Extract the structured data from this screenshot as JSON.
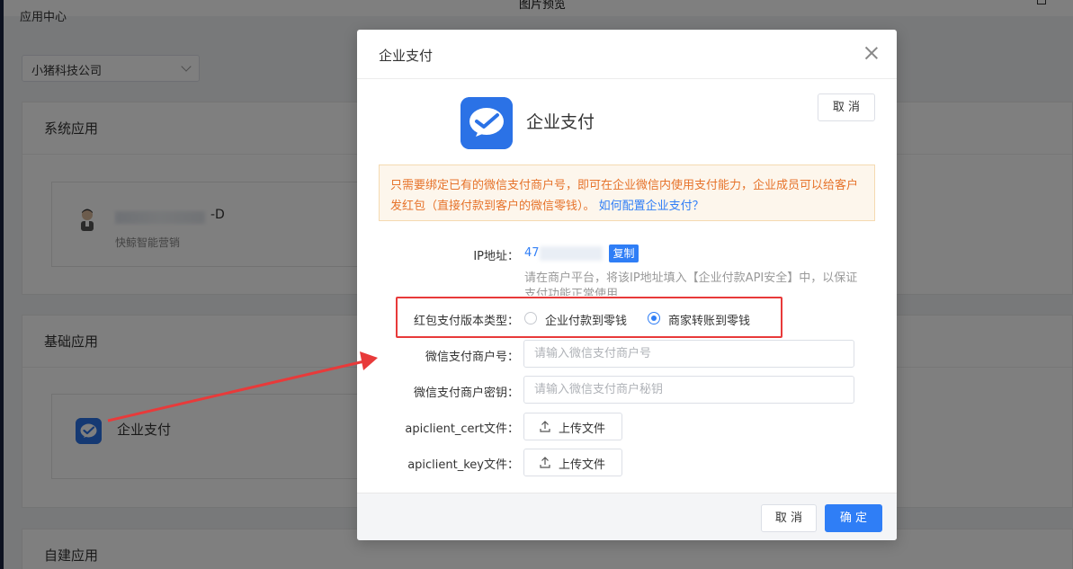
{
  "window": {
    "title": "图片预览"
  },
  "page": {
    "title": "应用中心",
    "company_select": {
      "value": "小猪科技公司"
    },
    "sections": {
      "system": {
        "heading": "系统应用",
        "app": {
          "name_suffix": "-D",
          "subtitle": "快鲸智能营销"
        }
      },
      "basic": {
        "heading": "基础应用",
        "app": {
          "name": "企业支付"
        }
      },
      "custom": {
        "heading": "自建应用"
      }
    }
  },
  "modal": {
    "title": "企业支付",
    "app_name": "企业支付",
    "cancel_top_label": "取 消",
    "notice": {
      "text": "只需要绑定已有的微信支付商户号，即可在企业微信内使用支付能力，企业成员可以给客户发红包（直接付款到客户的微信零钱）。",
      "link": "如何配置企业支付？"
    },
    "form": {
      "ip": {
        "label": "IP地址：",
        "value_prefix": "47",
        "copy_label": "复制",
        "hint": "请在商户平台，将该IP地址填入【企业付款API安全】中，以保证支付功能正常使用"
      },
      "version": {
        "label": "红包支付版本类型：",
        "options": [
          {
            "label": "企业付款到零钱",
            "checked": false
          },
          {
            "label": "商家转账到零钱",
            "checked": true
          }
        ]
      },
      "mch_id": {
        "label": "微信支付商户号：",
        "placeholder": "请输入微信支付商户号",
        "value": ""
      },
      "mch_key": {
        "label": "微信支付商户密钥：",
        "placeholder": "请输入微信支付商户秘钥",
        "value": ""
      },
      "cert": {
        "label": "apiclient_cert文件：",
        "button": "上传文件"
      },
      "key": {
        "label": "apiclient_key文件：",
        "button": "上传文件"
      }
    },
    "footer": {
      "cancel_label": "取 消",
      "ok_label": "确 定"
    }
  },
  "colors": {
    "primary": "#2f7ef6",
    "app_icon": "#2b72e6",
    "annotation": "#e83a3a",
    "notice_bg": "#fdf6ec",
    "notice_text": "#e6732b"
  }
}
